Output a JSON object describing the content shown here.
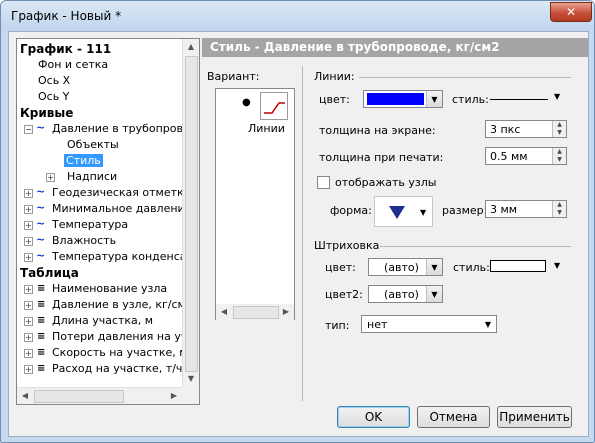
{
  "window": {
    "title": "График - Новый *",
    "close_label": "✕"
  },
  "tree": {
    "root": "График - 111",
    "root_items": [
      "Фон и сетка",
      "Ось X",
      "Ось Y"
    ],
    "curves_heading": "Кривые",
    "curve_main": "Давление в трубопровод",
    "curve_children": [
      "Объекты",
      "Стиль",
      "Надписи"
    ],
    "curves_rest": [
      "Геодезическая отметка",
      "Минимальное давление",
      "Температура",
      "Влажность",
      "Температура конденсац"
    ],
    "table_heading": "Таблица",
    "table_items": [
      "Наименование узла",
      "Давление в узле, кг/см",
      "Длина участка, м",
      "Потери давления на уча",
      "Скорость на участке, м/",
      "Расход на участке, т/ч"
    ]
  },
  "panel": {
    "header": "Стиль - Давление в трубопроводе, кг/см2",
    "variant_label": "Вариант:",
    "variant_item": "Линии",
    "lines_group": "Линии:",
    "color_label": "цвет:",
    "line_color": "#0000ff",
    "style_label": "стиль:",
    "width_screen_label": "толщина на экране:",
    "width_screen_value": "3 пкс",
    "width_print_label": "толщина при печати:",
    "width_print_value": "0.5 мм",
    "show_nodes_label": "отображать узлы",
    "show_nodes_checked": false,
    "shape_label": "форма:",
    "size_label": "размер:",
    "size_value": "3 мм",
    "hatch_group": "Штриховка",
    "hatch_color_label": "цвет:",
    "hatch_color_value": "(авто)",
    "hatch_style_label": "стиль:",
    "hatch_color2_label": "цвет2:",
    "hatch_color2_value": "(авто)",
    "type_label": "тип:",
    "type_value": "нет"
  },
  "buttons": {
    "ok": "OK",
    "cancel": "Отмена",
    "apply": "Применить"
  }
}
